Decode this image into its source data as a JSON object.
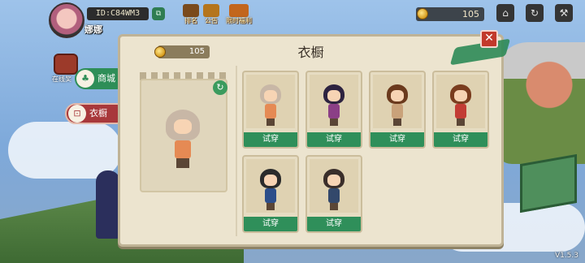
{
  "header": {
    "player_id": "ID:C84WM3",
    "player_name": "娜娜",
    "top_icons": [
      {
        "label": "排名",
        "icon": "ranking-icon",
        "color": "#7a4a1c"
      },
      {
        "label": "公告",
        "icon": "announcement-icon",
        "color": "#b5751c"
      },
      {
        "label": "限时福利",
        "icon": "limited-welfare-icon",
        "color": "#c2661d"
      }
    ],
    "coins": "105",
    "buttons": [
      {
        "icon": "gift-icon",
        "glyph": "⌂"
      },
      {
        "icon": "refresh-cycle-icon",
        "glyph": "↻"
      },
      {
        "icon": "settings-wrench-icon",
        "glyph": "⚒"
      }
    ]
  },
  "sidebar": {
    "badge_label": "在线奖",
    "mall_label": "商城",
    "wardrobe_label": "衣橱"
  },
  "panel": {
    "title": "衣橱",
    "coins": "105",
    "close_glyph": "✕",
    "refresh_glyph": "↻",
    "try_label": "试穿",
    "outfits": [
      {
        "hair": "#c8b7a6",
        "body": "#e58a54"
      },
      {
        "hair": "#2d2340",
        "body": "#8b3f86"
      },
      {
        "hair": "#6b3a1d",
        "body": "#c9a27a"
      },
      {
        "hair": "#7a3d1f",
        "body": "#c23c34"
      },
      {
        "hair": "#2b2b2b",
        "body": "#2c4e8a"
      },
      {
        "hair": "#3a2e2a",
        "body": "#33486b"
      }
    ]
  },
  "colors": {
    "accent_green": "#2f8f5a",
    "close_red": "#c2392b",
    "panel_bg": "#ece4cf"
  },
  "version": "V1.5.3"
}
